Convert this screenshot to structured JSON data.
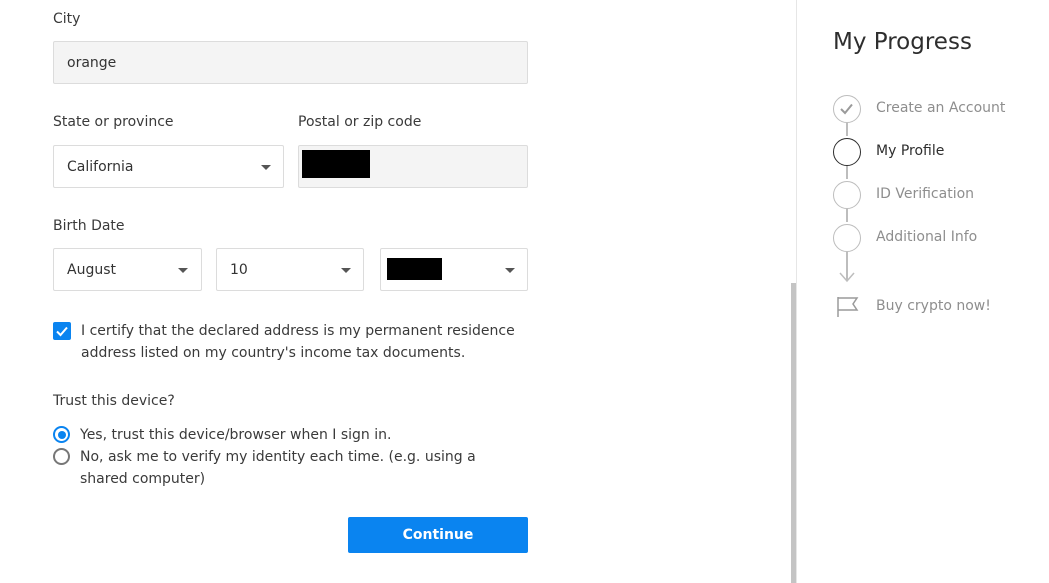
{
  "form": {
    "city": {
      "label": "City",
      "value": "orange"
    },
    "state": {
      "label": "State or province",
      "value": "California"
    },
    "postal": {
      "label": "Postal or zip code"
    },
    "birth_date": {
      "label": "Birth Date",
      "month": "August",
      "day": "10"
    },
    "certify": {
      "checked": true,
      "text": "I certify that the declared address is my permanent residence address listed on my country's income tax documents."
    },
    "trust": {
      "label": "Trust this device?",
      "options": [
        {
          "label": "Yes, trust this device/browser when I sign in.",
          "selected": true
        },
        {
          "label": "No, ask me to verify my identity each time. (e.g. using a shared computer)",
          "selected": false
        }
      ]
    },
    "continue_label": "Continue"
  },
  "progress": {
    "title": "My Progress",
    "steps": [
      {
        "label": "Create an Account",
        "status": "done",
        "icon": "check-icon"
      },
      {
        "label": "My Profile",
        "status": "current"
      },
      {
        "label": "ID Verification",
        "status": "pending"
      },
      {
        "label": "Additional Info",
        "status": "pending"
      }
    ],
    "final_step": {
      "label": "Buy crypto now!",
      "icon": "flag-icon"
    }
  },
  "colors": {
    "accent": "#0a84f0",
    "field_bg": "#f4f4f4",
    "muted_text": "#8e8e8e"
  }
}
